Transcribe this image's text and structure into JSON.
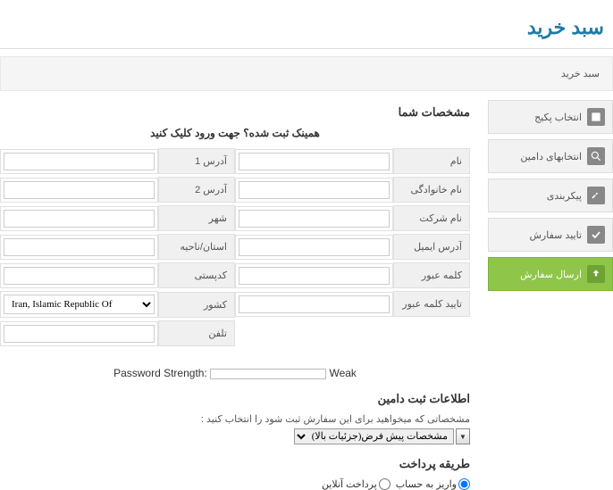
{
  "page_title": "سبد خرید",
  "breadcrumb": "سبد خرید",
  "sidebar": {
    "items": [
      {
        "label": "انتخاب پکیج"
      },
      {
        "label": "انتخابهای دامین"
      },
      {
        "label": "پیکربندی"
      },
      {
        "label": "تایید سفارش"
      },
      {
        "label": "ارسال سفارش"
      }
    ]
  },
  "section_details": "مشخصات شما",
  "login_prompt": "همینک ثبت شده؟ جهت ورود کلیک کنید",
  "fields_right": {
    "name": "نام",
    "lastname": "نام خانوادگی",
    "company": "نام شرکت",
    "email": "آدرس ایمیل",
    "password": "کلمه عبور",
    "password_confirm": "تایید کلمه عبور"
  },
  "fields_left": {
    "addr1": "آدرس 1",
    "addr2": "آدرس 2",
    "city": "شهر",
    "state": "استان/ناحیه",
    "zip": "کدپستی",
    "country": "کشور",
    "phone": "تلفن"
  },
  "country_value": "Iran, Islamic Republic Of",
  "pw_strength": {
    "label": "Password Strength:",
    "value": "Weak"
  },
  "domain_reg": {
    "title": "اطلاعات ثبت دامین",
    "desc": "مشخصاتی که میخواهید برای این سفارش ثبت شود را انتخاب کنید :",
    "select_value": "مشخصات پیش فرض(جزئیات بالا)"
  },
  "payment": {
    "title": "طریقه پرداخت",
    "opt1": "واریز به حساب",
    "opt2": "پرداخت آنلاین"
  }
}
